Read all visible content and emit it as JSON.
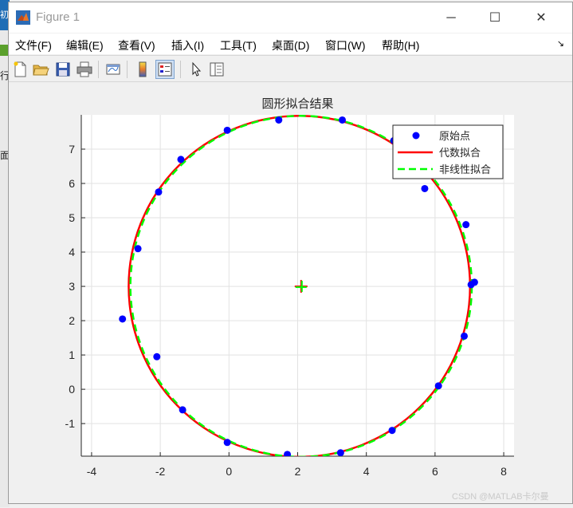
{
  "window": {
    "title": "Figure 1",
    "controls": {
      "minimize": "─",
      "maximize": "☐",
      "close": "✕"
    }
  },
  "desktop": {
    "blue_char": "初",
    "row_char": "行",
    "row2_char": "面"
  },
  "menu": [
    {
      "label": "文件(F)"
    },
    {
      "label": "编辑(E)"
    },
    {
      "label": "查看(V)"
    },
    {
      "label": "插入(I)"
    },
    {
      "label": "工具(T)"
    },
    {
      "label": "桌面(D)"
    },
    {
      "label": "窗口(W)"
    },
    {
      "label": "帮助(H)"
    }
  ],
  "menu_corner": "↘",
  "toolbar": [
    "new-figure-icon",
    "open-file-icon",
    "save-icon",
    "print-icon",
    "link-icon",
    "colorbar-icon",
    "legend-icon",
    "pointer-icon",
    "property-editor-icon"
  ],
  "watermark": "CSDN @MATLAB卡尔曼",
  "chart_data": {
    "type": "scatter",
    "title": "圆形拟合结果",
    "xlim": [
      -4.3,
      8.3
    ],
    "ylim": [
      -1.95,
      8.0
    ],
    "xticks": [
      -4,
      -2,
      0,
      2,
      4,
      6,
      8
    ],
    "yticks": [
      -1,
      0,
      1,
      2,
      3,
      4,
      5,
      6,
      7
    ],
    "grid": true,
    "legend_position": "top-right",
    "colors": {
      "points": "#0000ff",
      "algebraic": "#ff0000",
      "nonlinear": "#00ff00",
      "center": "#ff0000"
    },
    "series": [
      {
        "name": "原始点",
        "kind": "points",
        "x": [
          -0.05,
          1.45,
          3.3,
          4.8,
          5.7,
          6.9,
          7.05,
          7.15,
          6.85,
          6.1,
          4.75,
          3.25,
          1.7,
          -0.05,
          -1.35,
          -2.1,
          -3.1,
          -2.65,
          -2.05,
          -1.4
        ],
        "y": [
          7.55,
          7.85,
          7.85,
          7.25,
          5.85,
          4.8,
          3.05,
          3.12,
          1.55,
          0.1,
          -1.2,
          -1.85,
          -1.9,
          -1.55,
          -0.6,
          0.95,
          2.05,
          4.1,
          5.75,
          6.7
        ]
      },
      {
        "name": "代数拟合",
        "kind": "circle",
        "cx": 2.05,
        "cy": 3.0,
        "r": 4.97
      },
      {
        "name": "非线性拟合",
        "kind": "circle",
        "cx": 2.1,
        "cy": 3.0,
        "r": 4.97
      }
    ],
    "center_marker": {
      "x": 2.1,
      "y": 3.0
    }
  }
}
